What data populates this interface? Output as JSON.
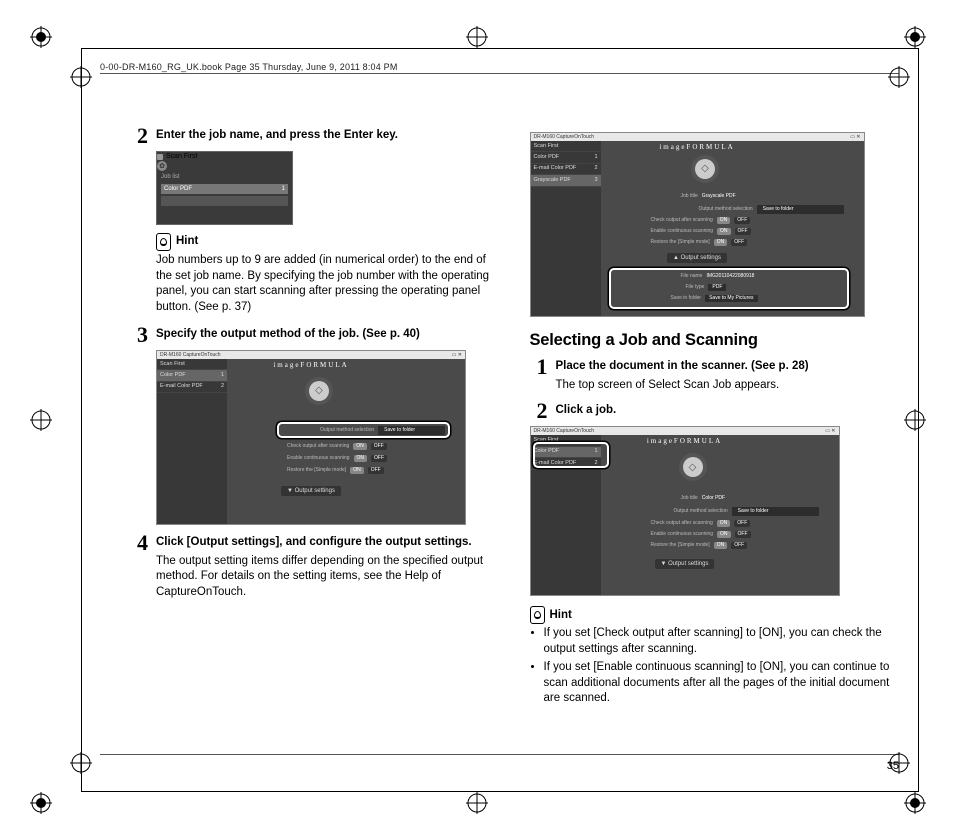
{
  "header": "0-00-DR-M160_RG_UK.book  Page 35  Thursday, June 9, 2011  8:04 PM",
  "page_number": "35",
  "hint_label": "Hint",
  "left": {
    "step2": {
      "num": "2",
      "head": "Enter the job name, and press the Enter key.",
      "dialog": {
        "title": "Scan First",
        "subtitle": "Job list",
        "item": "Color PDF",
        "item_count": "1"
      }
    },
    "hint_text": "Job numbers up to 9 are added (in numerical order) to the end of the set job name. By specifying the job number with the operating panel, you can start scanning after pressing the operating panel button. (See p. 37)",
    "step3": {
      "num": "3",
      "head": "Specify the output method of the job. (See p. 40)",
      "shot": {
        "title": "DR-M160 CaptureOnTouch",
        "brand": "imageFORMULA",
        "sidebar": [
          "Scan First",
          "Color PDF",
          "E-mail Color PDF"
        ],
        "rows": {
          "output_method": {
            "label": "Output method selection",
            "value": "Save to folder"
          },
          "check_after": {
            "label": "Check output after scanning",
            "value": "OFF"
          },
          "continuous": {
            "label": "Enable continuous scanning",
            "value": "OFF"
          },
          "simple": {
            "label": "Restore the [Simple mode]",
            "value": "OFF"
          }
        },
        "output_btn": "Output settings"
      }
    },
    "step4": {
      "num": "4",
      "head": "Click [Output settings], and configure the output settings.",
      "text": "The output setting items differ depending on the specified output method. For details on the setting items, see the Help of CaptureOnTouch."
    }
  },
  "right": {
    "top_shot": {
      "title": "DR-M160 CaptureOnTouch",
      "brand": "imageFORMULA",
      "sidebar": [
        "Scan First",
        "Color PDF",
        "E-mail Color PDF",
        "Grayscale PDF"
      ],
      "rows": {
        "jobtitle": {
          "label": "Job title",
          "value": "Grayscale PDF"
        },
        "output_method": {
          "label": "Output method selection",
          "value": "Save to folder"
        },
        "check_after": {
          "label": "Check output after scanning",
          "on": "ON",
          "off": "OFF"
        },
        "continuous": {
          "label": "Enable continuous scanning",
          "on": "ON",
          "off": "OFF"
        },
        "simple": {
          "label": "Restore the [Simple mode]",
          "on": "ON",
          "off": "OFF"
        },
        "filename": {
          "label": "File name",
          "value": "IMG20110422080918"
        },
        "filetype": {
          "label": "File type",
          "value": "PDF"
        },
        "savein": {
          "label": "Save in folder",
          "value": "Save to My Pictures"
        }
      },
      "output_btn": "Output settings"
    },
    "section": "Selecting a Job and Scanning",
    "step1": {
      "num": "1",
      "head": "Place the document in the scanner. (See p. 28)",
      "text": "The top screen of Select Scan Job appears."
    },
    "step2": {
      "num": "2",
      "head": "Click a job.",
      "shot": {
        "title": "DR-M160 CaptureOnTouch",
        "brand": "imageFORMULA",
        "sidebar": [
          "Scan First",
          "Color PDF",
          "E-mail Color PDF"
        ],
        "rows": {
          "jobtitle": {
            "label": "Job title",
            "value": "Color PDF"
          },
          "output_method": {
            "label": "Output method selection",
            "value": "Save to folder"
          },
          "check_after": {
            "label": "Check output after scanning",
            "on": "ON",
            "off": "OFF"
          },
          "continuous": {
            "label": "Enable continuous scanning",
            "on": "ON",
            "off": "OFF"
          },
          "simple": {
            "label": "Restore the [Simple mode]",
            "on": "ON",
            "off": "OFF"
          }
        },
        "output_btn": "Output settings"
      }
    },
    "hints": [
      "If you set [Check output after scanning] to [ON], you can check the output settings after scanning.",
      "If you set [Enable continuous scanning] to [ON], you can continue to scan additional documents after all the pages of the initial document are scanned."
    ]
  }
}
